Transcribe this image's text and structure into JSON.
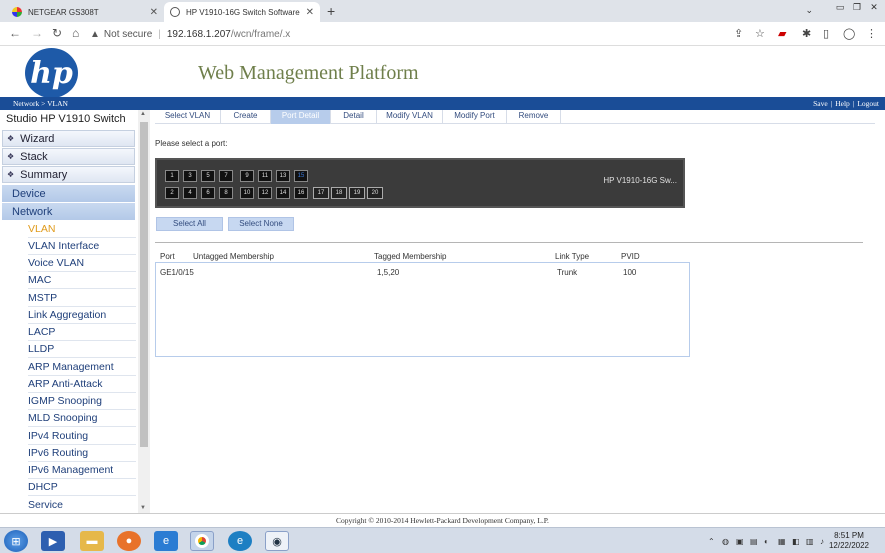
{
  "browser": {
    "tabs": [
      {
        "title": "NETGEAR GS308T",
        "active": false
      },
      {
        "title": "HP V1910-16G Switch Software W",
        "active": true
      }
    ],
    "new_tab": "+",
    "address": {
      "security_label": "Not secure",
      "host": "192.168.1.207",
      "path": "/wcn/frame/.x"
    }
  },
  "header": {
    "logo_text": "hp",
    "platform_title": "Web Management Platform",
    "breadcrumb": "Network > VLAN",
    "links": [
      "Save",
      "|",
      "Help",
      "|",
      "Logout"
    ]
  },
  "sidebar": {
    "device_title": "Studio HP V1910 Switch",
    "top_items": [
      "Wizard",
      "Stack",
      "Summary"
    ],
    "sections": [
      "Device",
      "Network"
    ],
    "network_items": [
      "VLAN",
      "VLAN Interface",
      "Voice VLAN",
      "MAC",
      "MSTP",
      "Link Aggregation",
      "LACP",
      "LLDP",
      "ARP Management",
      "ARP Anti-Attack",
      "IGMP Snooping",
      "MLD Snooping",
      "IPv4 Routing",
      "IPv6 Routing",
      "IPv6 Management",
      "DHCP",
      "Service"
    ],
    "active_item": "VLAN"
  },
  "content": {
    "tabs": [
      "Select VLAN",
      "Create",
      "Port Detail",
      "Detail",
      "Modify VLAN",
      "Modify Port",
      "Remove"
    ],
    "active_tab": "Port Detail",
    "select_port_label": "Please select a port:",
    "ports_top": [
      "1",
      "3",
      "5",
      "7",
      "9",
      "11",
      "13",
      "15"
    ],
    "ports_bottom": [
      "2",
      "4",
      "6",
      "8",
      "10",
      "12",
      "14",
      "16"
    ],
    "sfp_ports": [
      "17",
      "18",
      "19",
      "20"
    ],
    "selected_port": "15",
    "model_label": "HP V1910-16G Sw...",
    "buttons": {
      "select_all": "Select All",
      "select_none": "Select None"
    },
    "table": {
      "headers": [
        "Port",
        "Untagged Membership",
        "Tagged Membership",
        "Link Type",
        "PVID"
      ],
      "rows": [
        {
          "port": "GE1/0/15",
          "untagged": "",
          "tagged": "1,5,20",
          "link_type": "Trunk",
          "pvid": "100"
        }
      ]
    }
  },
  "footer": {
    "copyright": "Copyright © 2010-2014 Hewlett-Packard Development Company, L.P."
  },
  "taskbar": {
    "time": "8:51 PM",
    "date": "12/22/2022"
  }
}
